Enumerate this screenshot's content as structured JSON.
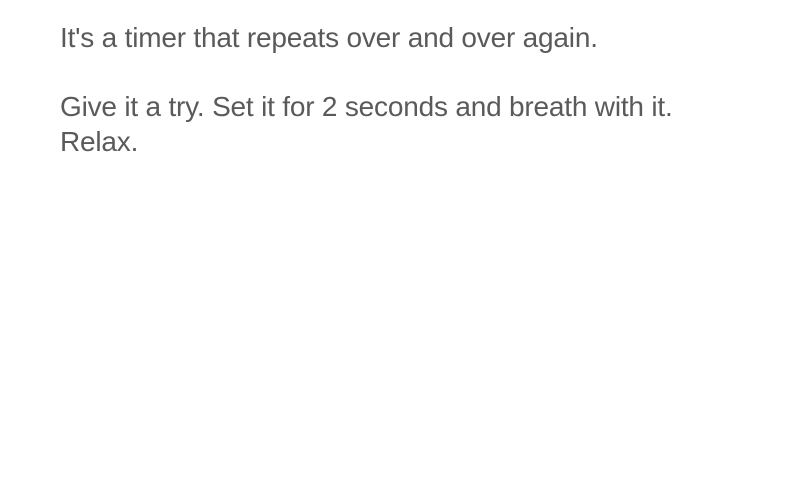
{
  "paragraphs": [
    "It's a timer that repeats over and over again.",
    "Give it a try. Set it for 2 seconds and breath with it. Relax."
  ]
}
